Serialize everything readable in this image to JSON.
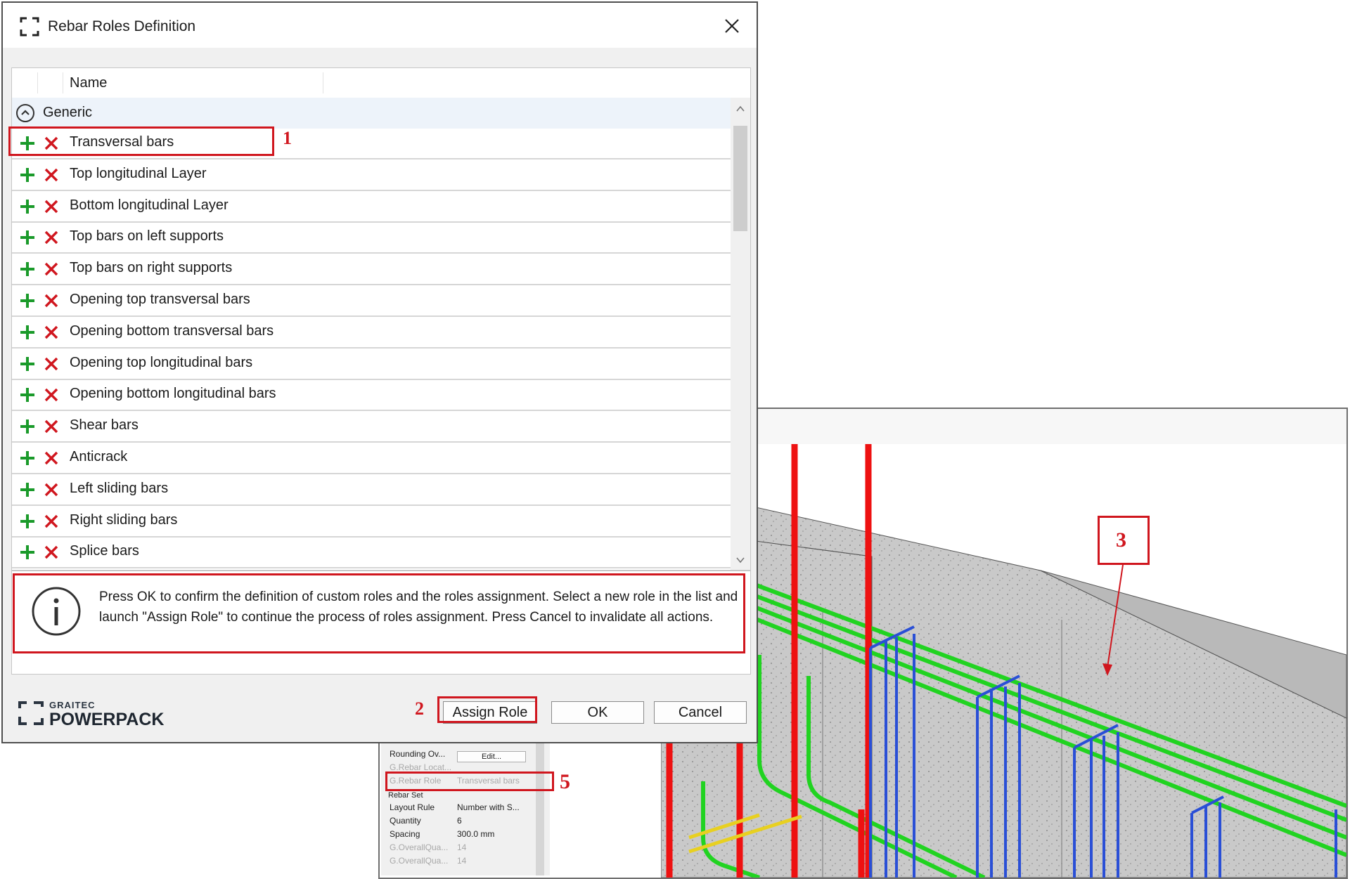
{
  "dialog": {
    "title": "Rebar Roles Definition",
    "close_icon": "close-icon",
    "list": {
      "column_name": "Name",
      "group": "Generic",
      "items": [
        "Transversal bars",
        "Top longitudinal Layer",
        "Bottom longitudinal Layer",
        "Top bars on left supports",
        "Top bars on right supports",
        "Opening top transversal bars",
        "Opening bottom transversal bars",
        "Opening top longitudinal bars",
        "Opening bottom longitudinal bars",
        "Shear bars",
        "Anticrack",
        "Left sliding bars",
        "Right sliding bars",
        "Splice bars"
      ]
    },
    "info_message": "Press OK to confirm the definition of custom roles and the roles assignment. Select a new role in the list and launch \"Assign Role\" to continue the process of roles assignment. Press Cancel to invalidate all actions.",
    "brand": {
      "line1": "GRAITEC",
      "line2": "POWERPACK"
    },
    "buttons": {
      "assign_role": "Assign Role",
      "ok": "OK",
      "cancel": "Cancel"
    }
  },
  "properties": {
    "rows": [
      {
        "key": "Rounding Ov...",
        "value": "Edit...",
        "dim": false
      },
      {
        "key": "G.Rebar Locat...",
        "value": "",
        "dim": true
      },
      {
        "key": "G.Rebar Role",
        "value": "Transversal bars",
        "dim": true
      },
      {
        "key": "Layout Rule",
        "value": "Number with S...",
        "dim": false
      },
      {
        "key": "Quantity",
        "value": "6",
        "dim": false
      },
      {
        "key": "Spacing",
        "value": "300.0 mm",
        "dim": false
      },
      {
        "key": "G.OverallQua...",
        "value": "14",
        "dim": true
      },
      {
        "key": "G.OverallQua...",
        "value": "14",
        "dim": true
      }
    ],
    "section": "Rebar Set"
  },
  "annotations": [
    "1",
    "2",
    "3",
    "5"
  ],
  "colors": {
    "highlight": "#d0161e",
    "add": "#1a9a2a",
    "delete": "#d0161e",
    "rebar_green": "#21d321",
    "rebar_red": "#ee1111",
    "rebar_blue": "#2a4fd6",
    "concrete": "#c9c9c9"
  }
}
